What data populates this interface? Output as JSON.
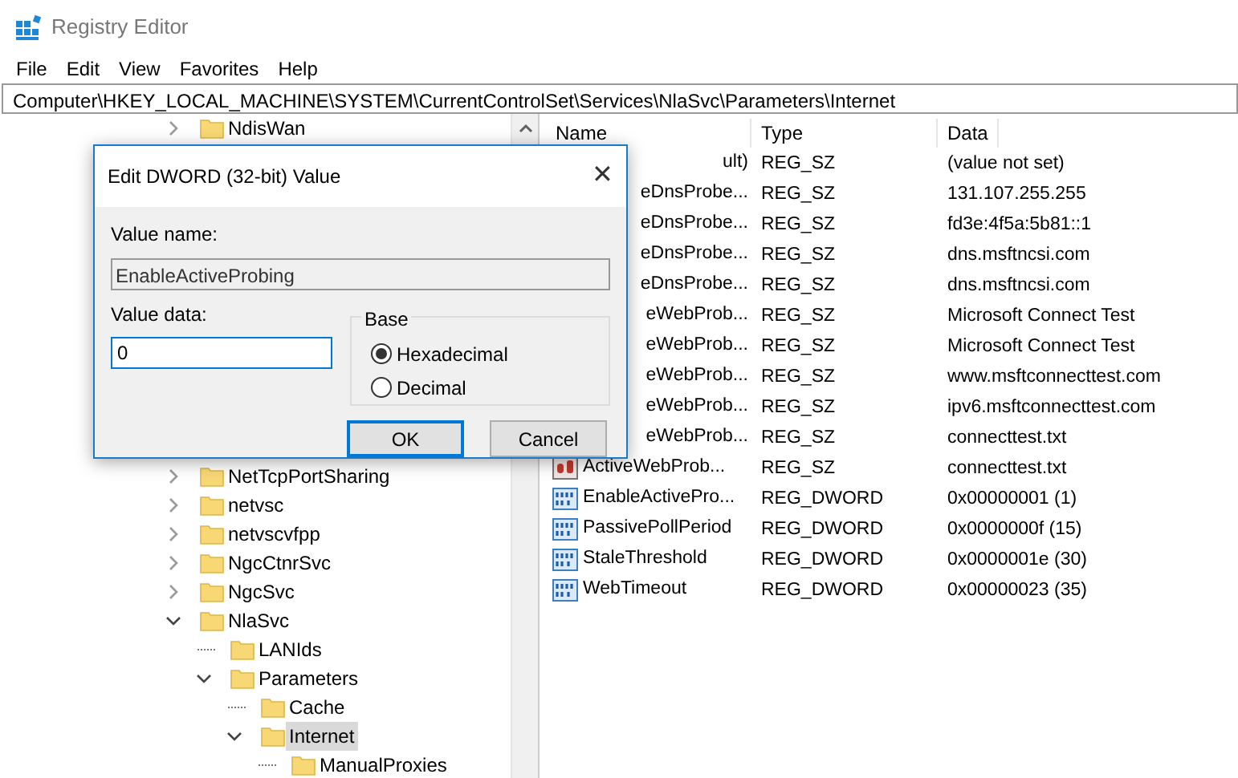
{
  "window": {
    "title": "Registry Editor"
  },
  "menu": [
    "File",
    "Edit",
    "View",
    "Favorites",
    "Help"
  ],
  "address": "Computer\\HKEY_LOCAL_MACHINE\\SYSTEM\\CurrentControlSet\\Services\\NlaSvc\\Parameters\\Internet",
  "tree": {
    "items": [
      {
        "label": "NdisWan",
        "kind": "branch",
        "expanded": false,
        "selected": false
      },
      {
        "label": "NetTcpPortSharing",
        "kind": "branch",
        "expanded": false,
        "selected": false
      },
      {
        "label": "netvsc",
        "kind": "branch",
        "expanded": false,
        "selected": false
      },
      {
        "label": "netvscvfpp",
        "kind": "branch",
        "expanded": false,
        "selected": false
      },
      {
        "label": "NgcCtnrSvc",
        "kind": "branch",
        "expanded": false,
        "selected": false
      },
      {
        "label": "NgcSvc",
        "kind": "branch",
        "expanded": false,
        "selected": false
      },
      {
        "label": "NlaSvc",
        "kind": "branch",
        "expanded": true,
        "selected": false,
        "children": [
          {
            "label": "LANIds",
            "kind": "leaf",
            "selected": false
          },
          {
            "label": "Parameters",
            "kind": "branch",
            "expanded": true,
            "selected": false,
            "children": [
              {
                "label": "Cache",
                "kind": "leaf",
                "selected": false
              },
              {
                "label": "Internet",
                "kind": "branch",
                "expanded": true,
                "selected": true,
                "children": [
                  {
                    "label": "ManualProxies",
                    "kind": "leaf",
                    "selected": false
                  }
                ]
              }
            ]
          }
        ]
      }
    ]
  },
  "list": {
    "columns": [
      "Name",
      "Type",
      "Data"
    ],
    "rows": [
      {
        "name": "ult)",
        "type": "REG_SZ",
        "data": "(value not set)"
      },
      {
        "name": "eDnsProbe...",
        "type": "REG_SZ",
        "data": "131.107.255.255"
      },
      {
        "name": "eDnsProbe...",
        "type": "REG_SZ",
        "data": "fd3e:4f5a:5b81::1"
      },
      {
        "name": "eDnsProbe...",
        "type": "REG_SZ",
        "data": "dns.msftncsi.com"
      },
      {
        "name": "eDnsProbe...",
        "type": "REG_SZ",
        "data": "dns.msftncsi.com"
      },
      {
        "name": "eWebProb...",
        "type": "REG_SZ",
        "data": "Microsoft Connect Test"
      },
      {
        "name": "eWebProb...",
        "type": "REG_SZ",
        "data": "Microsoft Connect Test"
      },
      {
        "name": "eWebProb...",
        "type": "REG_SZ",
        "data": "www.msftconnecttest.com"
      },
      {
        "name": "eWebProb...",
        "type": "REG_SZ",
        "data": "ipv6.msftconnecttest.com"
      },
      {
        "name": "eWebProb...",
        "type": "REG_SZ",
        "data": "connecttest.txt"
      },
      {
        "kind": "string",
        "name": "ActiveWebProb...",
        "type": "REG_SZ",
        "data": "connecttest.txt"
      },
      {
        "kind": "dword",
        "name": "EnableActivePro...",
        "type": "REG_DWORD",
        "data": "0x00000001 (1)"
      },
      {
        "kind": "dword",
        "name": "PassivePollPeriod",
        "type": "REG_DWORD",
        "data": "0x0000000f (15)"
      },
      {
        "kind": "dword",
        "name": "StaleThreshold",
        "type": "REG_DWORD",
        "data": "0x0000001e (30)"
      },
      {
        "kind": "dword",
        "name": "WebTimeout",
        "type": "REG_DWORD",
        "data": "0x00000023 (35)"
      }
    ]
  },
  "dialog": {
    "title": "Edit DWORD (32-bit) Value",
    "close": "✕",
    "value_name_label": "Value name:",
    "value_name": "EnableActiveProbing",
    "value_data_label": "Value data:",
    "value_data": "0",
    "base_label": "Base",
    "base_options": [
      {
        "label": "Hexadecimal",
        "selected": true
      },
      {
        "label": "Decimal",
        "selected": false
      }
    ],
    "buttons": [
      {
        "label": "OK",
        "default": true
      },
      {
        "label": "Cancel",
        "default": false
      }
    ]
  }
}
